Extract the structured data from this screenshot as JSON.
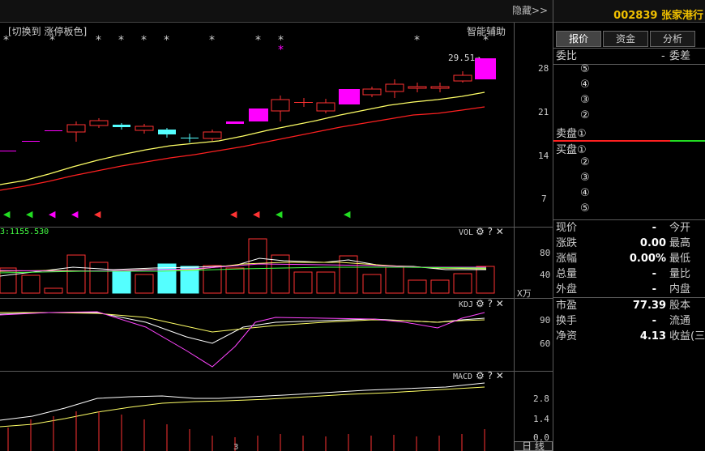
{
  "header": {
    "hide_label": "隐藏>>",
    "stock_code": "002839",
    "stock_name": "张家港行"
  },
  "main_chart": {
    "toggle_label": "[切换到 涨停板色]",
    "smart_label": "智能辅助",
    "price_tag": "29.51→",
    "y_labels": [
      "28",
      "21",
      "14",
      "7"
    ]
  },
  "vol": {
    "name": "VOL",
    "value_label": "3:1155.530",
    "y_labels": [
      "80",
      "40"
    ],
    "unit": "X万"
  },
  "kdj": {
    "name": "KDJ",
    "y_labels": [
      "90",
      "60"
    ]
  },
  "macd": {
    "name": "MACD",
    "y_labels": [
      "2.8",
      "1.4",
      "0.0"
    ]
  },
  "tools": {
    "gear": "⚙",
    "help": "?",
    "close": "✕"
  },
  "x_axis": {
    "month_label": "3"
  },
  "bottom": {
    "tab_label": "日 线"
  },
  "colors": {
    "up": "#ff3232",
    "down": "#54ffff",
    "limit_up": "#ff00ff",
    "ma_short": "#ffff66",
    "ma_long": "#ff2020",
    "buy_arrow": "#22dd22",
    "sell_arrow": "#ff3333",
    "accent": "#f0c000"
  },
  "right_panel": {
    "tabs": [
      "报价",
      "资金",
      "分析"
    ],
    "weibi_label": "委比",
    "weicha_label": "委差",
    "weibi_value": "-",
    "sell_label": "卖盘",
    "buy_label": "买盘",
    "levels": [
      "⑤",
      "④",
      "③",
      "②",
      "①"
    ],
    "buy_levels": [
      "①",
      "②",
      "③",
      "④",
      "⑤"
    ],
    "quote": [
      {
        "l": "现价",
        "v": "-",
        "r": "今开"
      },
      {
        "l": "涨跌",
        "v": "0.00",
        "r": "最高"
      },
      {
        "l": "涨幅",
        "v": "0.00%",
        "r": "最低"
      },
      {
        "l": "总量",
        "v": "-",
        "r": "量比"
      },
      {
        "l": "外盘",
        "v": "-",
        "r": "内盘"
      }
    ],
    "fundamentals": [
      {
        "l": "市盈",
        "v": "77.39",
        "r": "股本"
      },
      {
        "l": "换手",
        "v": "-",
        "r": "流通"
      },
      {
        "l": "净资",
        "v": "4.13",
        "r": "收益(三"
      }
    ]
  }
}
